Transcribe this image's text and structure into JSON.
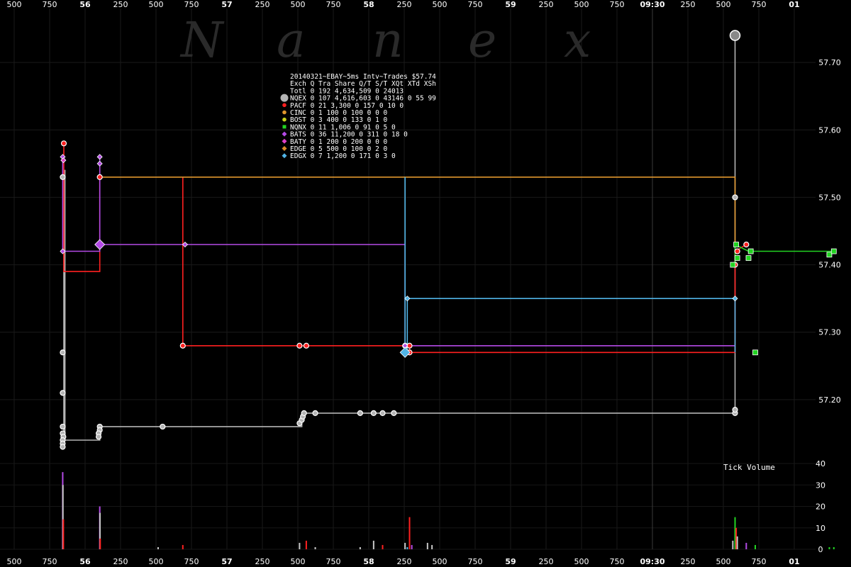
{
  "chart_data": {
    "type": "line",
    "title": "20140321~EBAY~5ms Intv~Trades $57.74",
    "watermark": [
      "N",
      "a",
      "n",
      "e",
      "x"
    ],
    "x_axis": {
      "labels": [
        "500",
        "750",
        "56",
        "250",
        "500",
        "750",
        "57",
        "250",
        "500",
        "750",
        "58",
        "250",
        "500",
        "750",
        "59",
        "250",
        "500",
        "750",
        "09:30",
        "250",
        "500",
        "750",
        "01"
      ],
      "major": [
        "56",
        "57",
        "58",
        "59",
        "09:30",
        "01"
      ],
      "range_ms": [
        -600,
        3650
      ],
      "session_open_ms": 3000
    },
    "y_axis": {
      "ticks": [
        "57.20",
        "57.30",
        "57.40",
        "57.50",
        "57.60",
        "57.70"
      ],
      "range": [
        57.12,
        57.78
      ]
    },
    "volume_axis": {
      "label": "Tick Volume",
      "ticks": [
        "0",
        "10",
        "20",
        "30",
        "40"
      ],
      "range": [
        0,
        42
      ]
    },
    "legend": {
      "header": "Exch Q Tra    Share  Q/T   S/T  XQt XTd XSh",
      "total": "Totl 0 192 4,634,509    0 24013",
      "rows": [
        {
          "name": "NQEX",
          "color": "#b4b4b4",
          "shape": "circle-big",
          "text": "NQEX 0 107 4,616,603    0 43146  0  55  99"
        },
        {
          "name": "PACF",
          "color": "#ff2020",
          "shape": "circle",
          "text": "PACF 0  21    3,300    0   157  0  10   0"
        },
        {
          "name": "CINC",
          "color": "#e0962d",
          "shape": "circle",
          "text": "CINC 0   1      100    0   100  0   0   0"
        },
        {
          "name": "BOST",
          "color": "#c8d21e",
          "shape": "circle",
          "text": "BOST 0   3      400    0   133  0   1   0"
        },
        {
          "name": "NQNX",
          "color": "#22d422",
          "shape": "square",
          "text": "NQNX 0  11    1,006    0    91  0   5   0"
        },
        {
          "name": "BATS",
          "color": "#b44ae6",
          "shape": "diamond",
          "text": "BATS 0  36   11,200    0   311  0  18   0"
        },
        {
          "name": "BATY",
          "color": "#e040c8",
          "shape": "diamond",
          "text": "BATY 0   1      200    0   200  0   0   0"
        },
        {
          "name": "EDGE",
          "color": "#dc8c28",
          "shape": "diamond",
          "text": "EDGE 0   5      500    0   100  0   2   0"
        },
        {
          "name": "EDGX",
          "color": "#50b4e6",
          "shape": "diamond",
          "text": "EDGX 0   7    1,200    0   171  0   3   0"
        }
      ]
    },
    "series": [
      {
        "name": "NQEX",
        "color": "#b4b4b4",
        "step": [
          [
            -125,
            57.15
          ],
          [
            -125,
            57.14
          ],
          [
            -120,
            57.14
          ],
          [
            -120,
            57.39
          ],
          [
            -120,
            57.54
          ],
          [
            -115,
            57.54
          ],
          [
            -115,
            57.14
          ],
          [
            40,
            57.14
          ],
          [
            40,
            57.16
          ],
          [
            940,
            57.16
          ],
          [
            940,
            57.18
          ],
          [
            2870,
            57.18
          ],
          [
            2870,
            57.74
          ]
        ],
        "markers": [
          [
            -125,
            57.53
          ],
          [
            -125,
            57.27
          ],
          [
            -125,
            57.21
          ],
          [
            -125,
            57.16
          ],
          [
            -125,
            57.15
          ],
          [
            -122,
            57.145
          ],
          [
            -125,
            57.14
          ],
          [
            -125,
            57.135
          ],
          [
            -125,
            57.13
          ],
          [
            40,
            57.16
          ],
          [
            40,
            57.155
          ],
          [
            35,
            57.15
          ],
          [
            35,
            57.145
          ],
          [
            320,
            57.16
          ],
          [
            930,
            57.165
          ],
          [
            940,
            57.17
          ],
          [
            945,
            57.175
          ],
          [
            950,
            57.18
          ],
          [
            1000,
            57.18
          ],
          [
            1200,
            57.18
          ],
          [
            1260,
            57.18
          ],
          [
            1300,
            57.18
          ],
          [
            1350,
            57.18
          ],
          [
            2870,
            57.18
          ],
          [
            2870,
            57.185
          ],
          [
            2870,
            57.5
          ]
        ],
        "big_markers": [
          [
            2870,
            57.74
          ]
        ]
      },
      {
        "name": "PACF",
        "color": "#ff2020",
        "step": [
          [
            -120,
            57.58
          ],
          [
            -120,
            57.39
          ],
          [
            40,
            57.39
          ],
          [
            40,
            57.53
          ],
          [
            40,
            57.53
          ]
        ],
        "step2": [
          [
            410,
            57.53
          ],
          [
            410,
            57.28
          ],
          [
            1420,
            57.28
          ],
          [
            1420,
            57.27
          ],
          [
            2870,
            57.27
          ],
          [
            2870,
            57.4
          ],
          [
            2870,
            57.42
          ],
          [
            2920,
            57.43
          ]
        ],
        "markers": [
          [
            -120,
            57.58
          ],
          [
            40,
            57.53
          ],
          [
            410,
            57.28
          ],
          [
            930,
            57.28
          ],
          [
            960,
            57.28
          ],
          [
            1400,
            57.28
          ],
          [
            1420,
            57.28
          ],
          [
            1420,
            57.27
          ],
          [
            2870,
            57.4
          ],
          [
            2880,
            57.42
          ],
          [
            2920,
            57.43
          ]
        ]
      },
      {
        "name": "CINC",
        "color": "#e0962d",
        "step": [
          [
            40,
            57.53
          ],
          [
            2870,
            57.53
          ],
          [
            2870,
            57.43
          ]
        ]
      },
      {
        "name": "NQNX",
        "color": "#22d422",
        "step": [
          [
            2870,
            57.4
          ],
          [
            2870,
            57.43
          ],
          [
            2930,
            57.42
          ],
          [
            2940,
            57.42
          ],
          [
            3300,
            57.42
          ]
        ],
        "markers": [
          [
            2860,
            57.4
          ],
          [
            2875,
            57.43
          ],
          [
            2880,
            57.41
          ],
          [
            2930,
            57.41
          ],
          [
            2940,
            57.42
          ],
          [
            3290,
            57.415
          ],
          [
            3310,
            57.42
          ],
          [
            2960,
            57.27
          ]
        ]
      },
      {
        "name": "BATS",
        "color": "#b44ae6",
        "step": [
          [
            -125,
            57.56
          ],
          [
            -125,
            57.42
          ],
          [
            40,
            57.42
          ],
          [
            40,
            57.56
          ],
          [
            40,
            57.43
          ],
          [
            1400,
            57.43
          ],
          [
            1400,
            57.28
          ],
          [
            2870,
            57.28
          ]
        ],
        "markers": [
          [
            -125,
            57.56
          ],
          [
            -125,
            57.42
          ],
          [
            40,
            57.56
          ],
          [
            40,
            57.55
          ],
          [
            40,
            57.43
          ],
          [
            420,
            57.43
          ],
          [
            1400,
            57.28
          ]
        ],
        "big_markers": [
          [
            40,
            57.43
          ]
        ]
      },
      {
        "name": "BATY",
        "color": "#e040c8",
        "markers": [
          [
            -122,
            57.555
          ]
        ]
      },
      {
        "name": "EDGX",
        "color": "#50b4e6",
        "step": [
          [
            1400,
            57.27
          ],
          [
            1400,
            57.53
          ]
        ],
        "step2": [
          [
            1410,
            57.27
          ],
          [
            1410,
            57.35
          ],
          [
            2870,
            57.35
          ],
          [
            2870,
            57.27
          ]
        ],
        "markers": [
          [
            1410,
            57.35
          ],
          [
            2870,
            57.35
          ]
        ],
        "big_markers": [
          [
            1400,
            57.27
          ]
        ]
      }
    ],
    "volume_bars": [
      {
        "x": -125,
        "h": 36,
        "color": "#b44ae6"
      },
      {
        "x": -124,
        "h": 30,
        "color": "#c8c8c8"
      },
      {
        "x": -122,
        "h": 14,
        "color": "#ff2020"
      },
      {
        "x": 40,
        "h": 20,
        "color": "#b44ae6"
      },
      {
        "x": 41,
        "h": 17,
        "color": "#c8c8c8"
      },
      {
        "x": 42,
        "h": 5,
        "color": "#ff2020"
      },
      {
        "x": 300,
        "h": 1,
        "color": "#c8c8c8"
      },
      {
        "x": 410,
        "h": 2,
        "color": "#ff2020"
      },
      {
        "x": 930,
        "h": 3,
        "color": "#c8c8c8"
      },
      {
        "x": 960,
        "h": 4,
        "color": "#ff2020"
      },
      {
        "x": 1000,
        "h": 1,
        "color": "#c8c8c8"
      },
      {
        "x": 1200,
        "h": 1,
        "color": "#c8c8c8"
      },
      {
        "x": 1260,
        "h": 4,
        "color": "#c8c8c8"
      },
      {
        "x": 1300,
        "h": 2,
        "color": "#ff2020"
      },
      {
        "x": 1400,
        "h": 3,
        "color": "#c8c8c8"
      },
      {
        "x": 1410,
        "h": 1,
        "color": "#50b4e6"
      },
      {
        "x": 1420,
        "h": 15,
        "color": "#ff2020"
      },
      {
        "x": 1430,
        "h": 2,
        "color": "#b44ae6"
      },
      {
        "x": 1500,
        "h": 3,
        "color": "#c8c8c8"
      },
      {
        "x": 1520,
        "h": 2,
        "color": "#c8c8c8"
      },
      {
        "x": 2860,
        "h": 4,
        "color": "#c8c8c8"
      },
      {
        "x": 2870,
        "h": 15,
        "color": "#22d422"
      },
      {
        "x": 2875,
        "h": 10,
        "color": "#ff2020"
      },
      {
        "x": 2880,
        "h": 6,
        "color": "#c8c8c8"
      },
      {
        "x": 2920,
        "h": 3,
        "color": "#b44ae6"
      },
      {
        "x": 2960,
        "h": 2,
        "color": "#22d422"
      },
      {
        "x": 3290,
        "h": 1,
        "color": "#22d422"
      },
      {
        "x": 3310,
        "h": 1,
        "color": "#22d422"
      }
    ]
  }
}
